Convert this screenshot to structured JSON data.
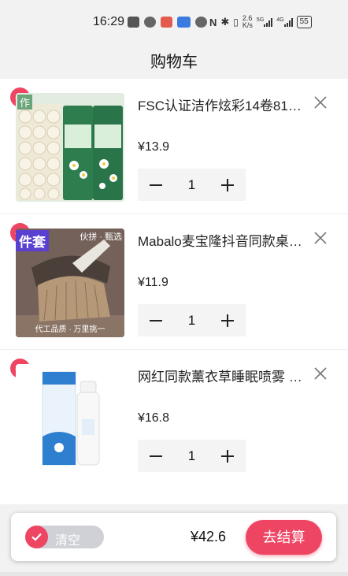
{
  "status_bar": {
    "time": "16:29",
    "net_speed_top": "2.6",
    "net_speed_bottom": "K/s",
    "signal_1_label": "5G",
    "signal_2_label": "4G",
    "battery": "55"
  },
  "header": {
    "title": "购物车"
  },
  "cart": {
    "items": [
      {
        "name": "FSC认证洁作炫彩14卷81…",
        "price": "¥13.9",
        "quantity": "1",
        "selected": true,
        "thumb_caption": "作"
      },
      {
        "name": "Mabalo麦宝隆抖音同款桌…",
        "price": "¥11.9",
        "quantity": "1",
        "selected": true,
        "thumb_caption": "件套",
        "thumb_badge": "伙拼 · 甄选",
        "thumb_footer": "代工品质 · 万里挑一"
      },
      {
        "name": "网红同款薰衣草睡眠喷雾 …",
        "price": "¥16.8",
        "quantity": "1",
        "selected": true
      }
    ]
  },
  "bottom_bar": {
    "clear_label": "清空",
    "total": "¥42.6",
    "checkout_label": "去结算"
  },
  "colors": {
    "accent": "#ee4563",
    "stepper_bg": "#f4f4f4",
    "page_bg": "#f2f2f2"
  }
}
